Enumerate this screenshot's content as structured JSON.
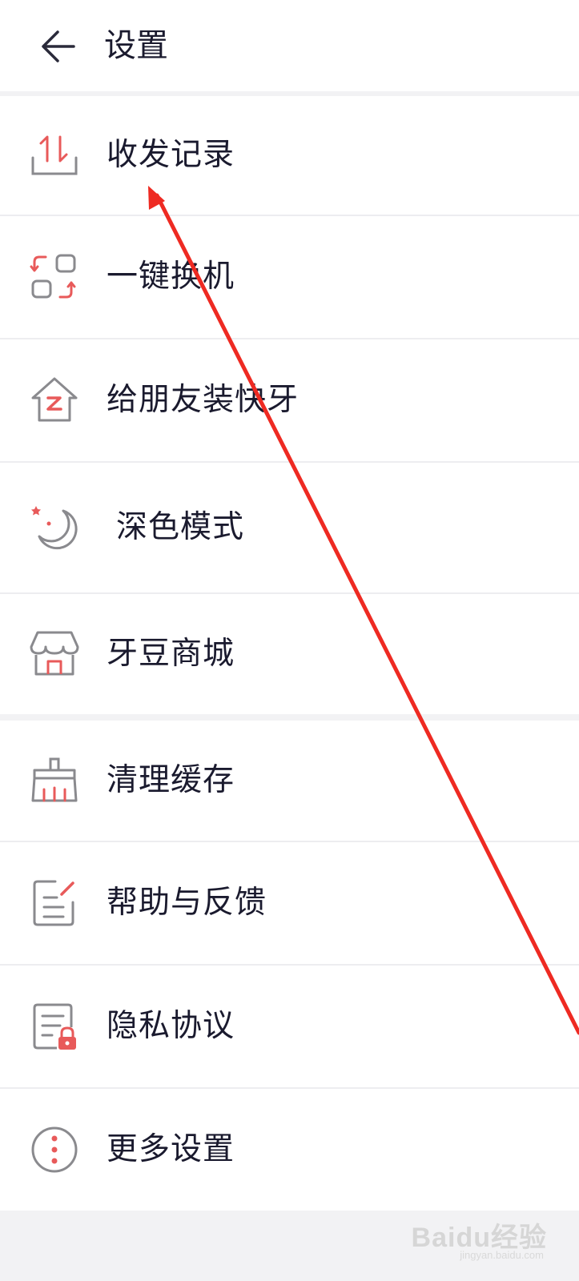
{
  "header": {
    "title": "设置",
    "back_icon": "arrow-left-icon"
  },
  "menu": {
    "items": [
      {
        "label": "收发记录",
        "icon": "transfer-record-icon"
      },
      {
        "label": "一键换机",
        "icon": "phone-switch-icon"
      },
      {
        "label": "给朋友装快牙",
        "icon": "share-house-icon"
      },
      {
        "label": "深色模式",
        "icon": "moon-icon"
      },
      {
        "label": "牙豆商城",
        "icon": "store-icon"
      },
      {
        "label": "清理缓存",
        "icon": "broom-icon"
      },
      {
        "label": "帮助与反馈",
        "icon": "feedback-icon"
      },
      {
        "label": "隐私协议",
        "icon": "privacy-doc-icon"
      },
      {
        "label": "更多设置",
        "icon": "more-icon"
      }
    ]
  },
  "watermark": {
    "text": "Baidu经验",
    "sub": "jingyan.baidu.com"
  },
  "colors": {
    "accent": "#e85a5a",
    "icon_gray": "#8a8a8e",
    "text": "#1a1a2e",
    "annotation_arrow": "#ee2a22"
  }
}
